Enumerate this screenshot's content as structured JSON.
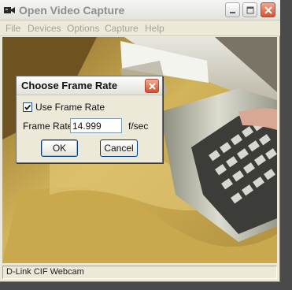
{
  "window": {
    "title": "Open Video Capture",
    "icon": "camera-icon"
  },
  "menu": {
    "items": [
      "File",
      "Devices",
      "Options",
      "Capture",
      "Help"
    ]
  },
  "status_bar": {
    "text": "D-Link CIF Webcam"
  },
  "dialog": {
    "title": "Choose Frame Rate",
    "use_frame_rate": {
      "label": "Use Frame Rate",
      "checked": true
    },
    "frame_rate": {
      "label": "Frame Rate:",
      "value": "14.999",
      "unit": "f/sec"
    },
    "ok_label": "OK",
    "cancel_label": "Cancel"
  },
  "colors": {
    "dialog_bg": "#ece9d8",
    "close_button": "#d84c27",
    "title_disabled": "#8e8e8e"
  }
}
